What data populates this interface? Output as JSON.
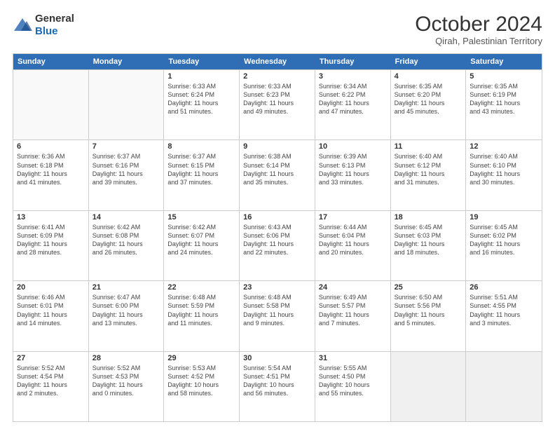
{
  "logo": {
    "general": "General",
    "blue": "Blue"
  },
  "header": {
    "month": "October 2024",
    "location": "Qirah, Palestinian Territory"
  },
  "weekdays": [
    "Sunday",
    "Monday",
    "Tuesday",
    "Wednesday",
    "Thursday",
    "Friday",
    "Saturday"
  ],
  "rows": [
    [
      {
        "day": "",
        "lines": []
      },
      {
        "day": "",
        "lines": []
      },
      {
        "day": "1",
        "lines": [
          "Sunrise: 6:33 AM",
          "Sunset: 6:24 PM",
          "Daylight: 11 hours",
          "and 51 minutes."
        ]
      },
      {
        "day": "2",
        "lines": [
          "Sunrise: 6:33 AM",
          "Sunset: 6:23 PM",
          "Daylight: 11 hours",
          "and 49 minutes."
        ]
      },
      {
        "day": "3",
        "lines": [
          "Sunrise: 6:34 AM",
          "Sunset: 6:22 PM",
          "Daylight: 11 hours",
          "and 47 minutes."
        ]
      },
      {
        "day": "4",
        "lines": [
          "Sunrise: 6:35 AM",
          "Sunset: 6:20 PM",
          "Daylight: 11 hours",
          "and 45 minutes."
        ]
      },
      {
        "day": "5",
        "lines": [
          "Sunrise: 6:35 AM",
          "Sunset: 6:19 PM",
          "Daylight: 11 hours",
          "and 43 minutes."
        ]
      }
    ],
    [
      {
        "day": "6",
        "lines": [
          "Sunrise: 6:36 AM",
          "Sunset: 6:18 PM",
          "Daylight: 11 hours",
          "and 41 minutes."
        ]
      },
      {
        "day": "7",
        "lines": [
          "Sunrise: 6:37 AM",
          "Sunset: 6:16 PM",
          "Daylight: 11 hours",
          "and 39 minutes."
        ]
      },
      {
        "day": "8",
        "lines": [
          "Sunrise: 6:37 AM",
          "Sunset: 6:15 PM",
          "Daylight: 11 hours",
          "and 37 minutes."
        ]
      },
      {
        "day": "9",
        "lines": [
          "Sunrise: 6:38 AM",
          "Sunset: 6:14 PM",
          "Daylight: 11 hours",
          "and 35 minutes."
        ]
      },
      {
        "day": "10",
        "lines": [
          "Sunrise: 6:39 AM",
          "Sunset: 6:13 PM",
          "Daylight: 11 hours",
          "and 33 minutes."
        ]
      },
      {
        "day": "11",
        "lines": [
          "Sunrise: 6:40 AM",
          "Sunset: 6:12 PM",
          "Daylight: 11 hours",
          "and 31 minutes."
        ]
      },
      {
        "day": "12",
        "lines": [
          "Sunrise: 6:40 AM",
          "Sunset: 6:10 PM",
          "Daylight: 11 hours",
          "and 30 minutes."
        ]
      }
    ],
    [
      {
        "day": "13",
        "lines": [
          "Sunrise: 6:41 AM",
          "Sunset: 6:09 PM",
          "Daylight: 11 hours",
          "and 28 minutes."
        ]
      },
      {
        "day": "14",
        "lines": [
          "Sunrise: 6:42 AM",
          "Sunset: 6:08 PM",
          "Daylight: 11 hours",
          "and 26 minutes."
        ]
      },
      {
        "day": "15",
        "lines": [
          "Sunrise: 6:42 AM",
          "Sunset: 6:07 PM",
          "Daylight: 11 hours",
          "and 24 minutes."
        ]
      },
      {
        "day": "16",
        "lines": [
          "Sunrise: 6:43 AM",
          "Sunset: 6:06 PM",
          "Daylight: 11 hours",
          "and 22 minutes."
        ]
      },
      {
        "day": "17",
        "lines": [
          "Sunrise: 6:44 AM",
          "Sunset: 6:04 PM",
          "Daylight: 11 hours",
          "and 20 minutes."
        ]
      },
      {
        "day": "18",
        "lines": [
          "Sunrise: 6:45 AM",
          "Sunset: 6:03 PM",
          "Daylight: 11 hours",
          "and 18 minutes."
        ]
      },
      {
        "day": "19",
        "lines": [
          "Sunrise: 6:45 AM",
          "Sunset: 6:02 PM",
          "Daylight: 11 hours",
          "and 16 minutes."
        ]
      }
    ],
    [
      {
        "day": "20",
        "lines": [
          "Sunrise: 6:46 AM",
          "Sunset: 6:01 PM",
          "Daylight: 11 hours",
          "and 14 minutes."
        ]
      },
      {
        "day": "21",
        "lines": [
          "Sunrise: 6:47 AM",
          "Sunset: 6:00 PM",
          "Daylight: 11 hours",
          "and 13 minutes."
        ]
      },
      {
        "day": "22",
        "lines": [
          "Sunrise: 6:48 AM",
          "Sunset: 5:59 PM",
          "Daylight: 11 hours",
          "and 11 minutes."
        ]
      },
      {
        "day": "23",
        "lines": [
          "Sunrise: 6:48 AM",
          "Sunset: 5:58 PM",
          "Daylight: 11 hours",
          "and 9 minutes."
        ]
      },
      {
        "day": "24",
        "lines": [
          "Sunrise: 6:49 AM",
          "Sunset: 5:57 PM",
          "Daylight: 11 hours",
          "and 7 minutes."
        ]
      },
      {
        "day": "25",
        "lines": [
          "Sunrise: 6:50 AM",
          "Sunset: 5:56 PM",
          "Daylight: 11 hours",
          "and 5 minutes."
        ]
      },
      {
        "day": "26",
        "lines": [
          "Sunrise: 5:51 AM",
          "Sunset: 4:55 PM",
          "Daylight: 11 hours",
          "and 3 minutes."
        ]
      }
    ],
    [
      {
        "day": "27",
        "lines": [
          "Sunrise: 5:52 AM",
          "Sunset: 4:54 PM",
          "Daylight: 11 hours",
          "and 2 minutes."
        ]
      },
      {
        "day": "28",
        "lines": [
          "Sunrise: 5:52 AM",
          "Sunset: 4:53 PM",
          "Daylight: 11 hours",
          "and 0 minutes."
        ]
      },
      {
        "day": "29",
        "lines": [
          "Sunrise: 5:53 AM",
          "Sunset: 4:52 PM",
          "Daylight: 10 hours",
          "and 58 minutes."
        ]
      },
      {
        "day": "30",
        "lines": [
          "Sunrise: 5:54 AM",
          "Sunset: 4:51 PM",
          "Daylight: 10 hours",
          "and 56 minutes."
        ]
      },
      {
        "day": "31",
        "lines": [
          "Sunrise: 5:55 AM",
          "Sunset: 4:50 PM",
          "Daylight: 10 hours",
          "and 55 minutes."
        ]
      },
      {
        "day": "",
        "lines": []
      },
      {
        "day": "",
        "lines": []
      }
    ]
  ]
}
